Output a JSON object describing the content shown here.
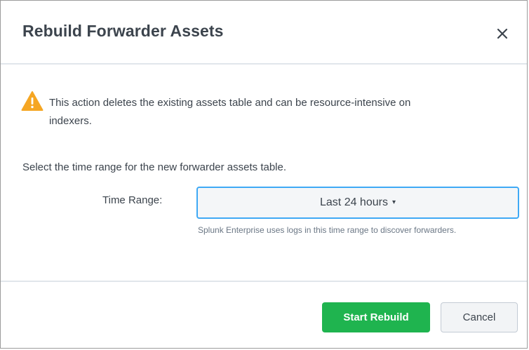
{
  "dialog": {
    "title": "Rebuild Forwarder Assets",
    "close_icon": "close-icon"
  },
  "warning": {
    "icon": "warning-triangle-icon",
    "icon_color": "#f5a623",
    "text": "This action deletes the existing assets table and can be resource-intensive on indexers."
  },
  "form": {
    "instruction": "Select the time range for the new forwarder assets table.",
    "time_range_label": "Time Range:",
    "time_range_value": "Last 24 hours",
    "time_range_caret": "▾",
    "help_text": "Splunk Enterprise uses logs in this time range to discover forwarders."
  },
  "footer": {
    "start_label": "Start Rebuild",
    "start_color": "#1fb44f",
    "cancel_label": "Cancel"
  }
}
